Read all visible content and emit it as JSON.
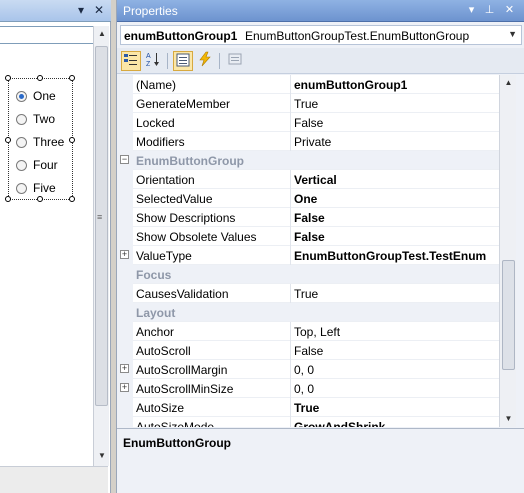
{
  "left_pane": {
    "close_glyph": "✕",
    "dropdown_glyph": "▾",
    "radio_options": [
      {
        "label": "One",
        "checked": true
      },
      {
        "label": "Two",
        "checked": false
      },
      {
        "label": "Three",
        "checked": false
      },
      {
        "label": "Four",
        "checked": false
      },
      {
        "label": "Five",
        "checked": false
      }
    ]
  },
  "properties": {
    "title": "Properties",
    "pin_glyph": "⊥",
    "close_glyph": "✕",
    "dropdown_glyph": "▾",
    "object_name": "enumButtonGroup1",
    "object_type": "EnumButtonGroupTest.EnumButtonGroup",
    "toolbar": {
      "categorized_icon": "categorized-icon",
      "alphabetical_icon": "alphabetical-icon",
      "properties_icon": "properties-icon",
      "events_icon": "events-icon",
      "property_pages_icon": "property-pages-icon"
    },
    "rows": [
      {
        "kind": "prop",
        "name": "(Name)",
        "value": "enumButtonGroup1",
        "bold": true,
        "expandable": false
      },
      {
        "kind": "prop",
        "name": "GenerateMember",
        "value": "True",
        "bold": false,
        "expandable": false
      },
      {
        "kind": "prop",
        "name": "Locked",
        "value": "False",
        "bold": false,
        "expandable": false
      },
      {
        "kind": "prop",
        "name": "Modifiers",
        "value": "Private",
        "bold": false,
        "expandable": false
      },
      {
        "kind": "category",
        "name": "EnumButtonGroup",
        "collapsible": true
      },
      {
        "kind": "prop",
        "name": "Orientation",
        "value": "Vertical",
        "bold": true,
        "expandable": false
      },
      {
        "kind": "prop",
        "name": "SelectedValue",
        "value": "One",
        "bold": true,
        "expandable": false
      },
      {
        "kind": "prop",
        "name": "Show Descriptions",
        "value": "False",
        "bold": true,
        "expandable": false
      },
      {
        "kind": "prop",
        "name": "Show Obsolete Values",
        "value": "False",
        "bold": true,
        "expandable": false
      },
      {
        "kind": "prop",
        "name": "ValueType",
        "value": "EnumButtonGroupTest.TestEnum",
        "bold": true,
        "expandable": true
      },
      {
        "kind": "category",
        "name": "Focus",
        "collapsible": false
      },
      {
        "kind": "prop",
        "name": "CausesValidation",
        "value": "True",
        "bold": false,
        "expandable": false
      },
      {
        "kind": "category",
        "name": "Layout",
        "collapsible": false
      },
      {
        "kind": "prop",
        "name": "Anchor",
        "value": "Top, Left",
        "bold": false,
        "expandable": false
      },
      {
        "kind": "prop",
        "name": "AutoScroll",
        "value": "False",
        "bold": false,
        "expandable": false
      },
      {
        "kind": "prop",
        "name": "AutoScrollMargin",
        "value": "0, 0",
        "bold": false,
        "expandable": true
      },
      {
        "kind": "prop",
        "name": "AutoScrollMinSize",
        "value": "0, 0",
        "bold": false,
        "expandable": true
      },
      {
        "kind": "prop",
        "name": "AutoSize",
        "value": "True",
        "bold": true,
        "expandable": false
      },
      {
        "kind": "prop",
        "name": "AutoSizeMode",
        "value": "GrowAndShrink",
        "bold": true,
        "expandable": false
      }
    ],
    "description_title": "EnumButtonGroup",
    "colors": {
      "title_bar": "#6d93cf",
      "category_text": "#8e97a8",
      "grid_background": "#ffffff",
      "selected_toolbar_button": "#fbe7a8"
    }
  }
}
